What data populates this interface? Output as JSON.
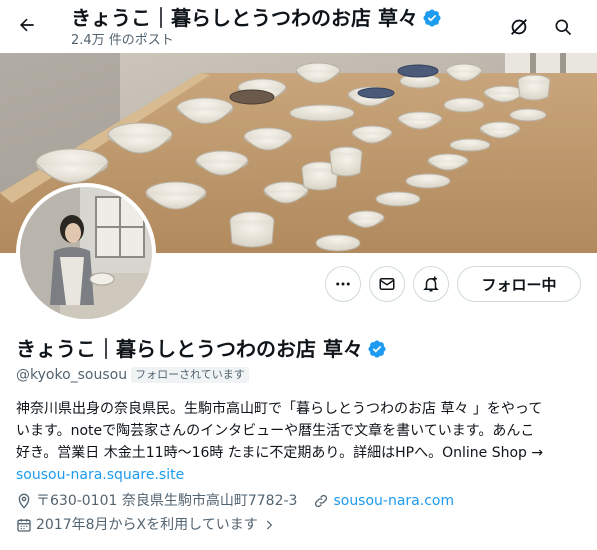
{
  "header": {
    "title": "きょうこ｜暮らしとうつわのお店 草々",
    "post_count": "2.4万 件のポスト"
  },
  "profile": {
    "name": "きょうこ｜暮らしとうつわのお店 草々",
    "handle": "@kyoko_sousou",
    "follows_you_badge": "フォローされています",
    "follow_button_label": "フォロー中",
    "bio": {
      "line1": "神奈川県出身の奈良県民。生駒市高山町で「暮らしとうつわのお店 草々 」をやって",
      "line2": "います。noteで陶芸家さんのインタビューや暦生活で文章を書いています。あんこ",
      "line3": "好き。営業日 木金土11時〜16時 たまに不定期あり。詳細はHPへ。Online Shop →",
      "link": "sousou-nara.square.site"
    },
    "location": "〒630-0101 奈良県生駒市高山町7782-3",
    "website": "sousou-nara.com",
    "joined": "2017年8月からXを利用しています"
  },
  "colors": {
    "accent": "#1d9bf0",
    "text": "#0f1419",
    "muted": "#536471",
    "border": "#cfd9de"
  }
}
